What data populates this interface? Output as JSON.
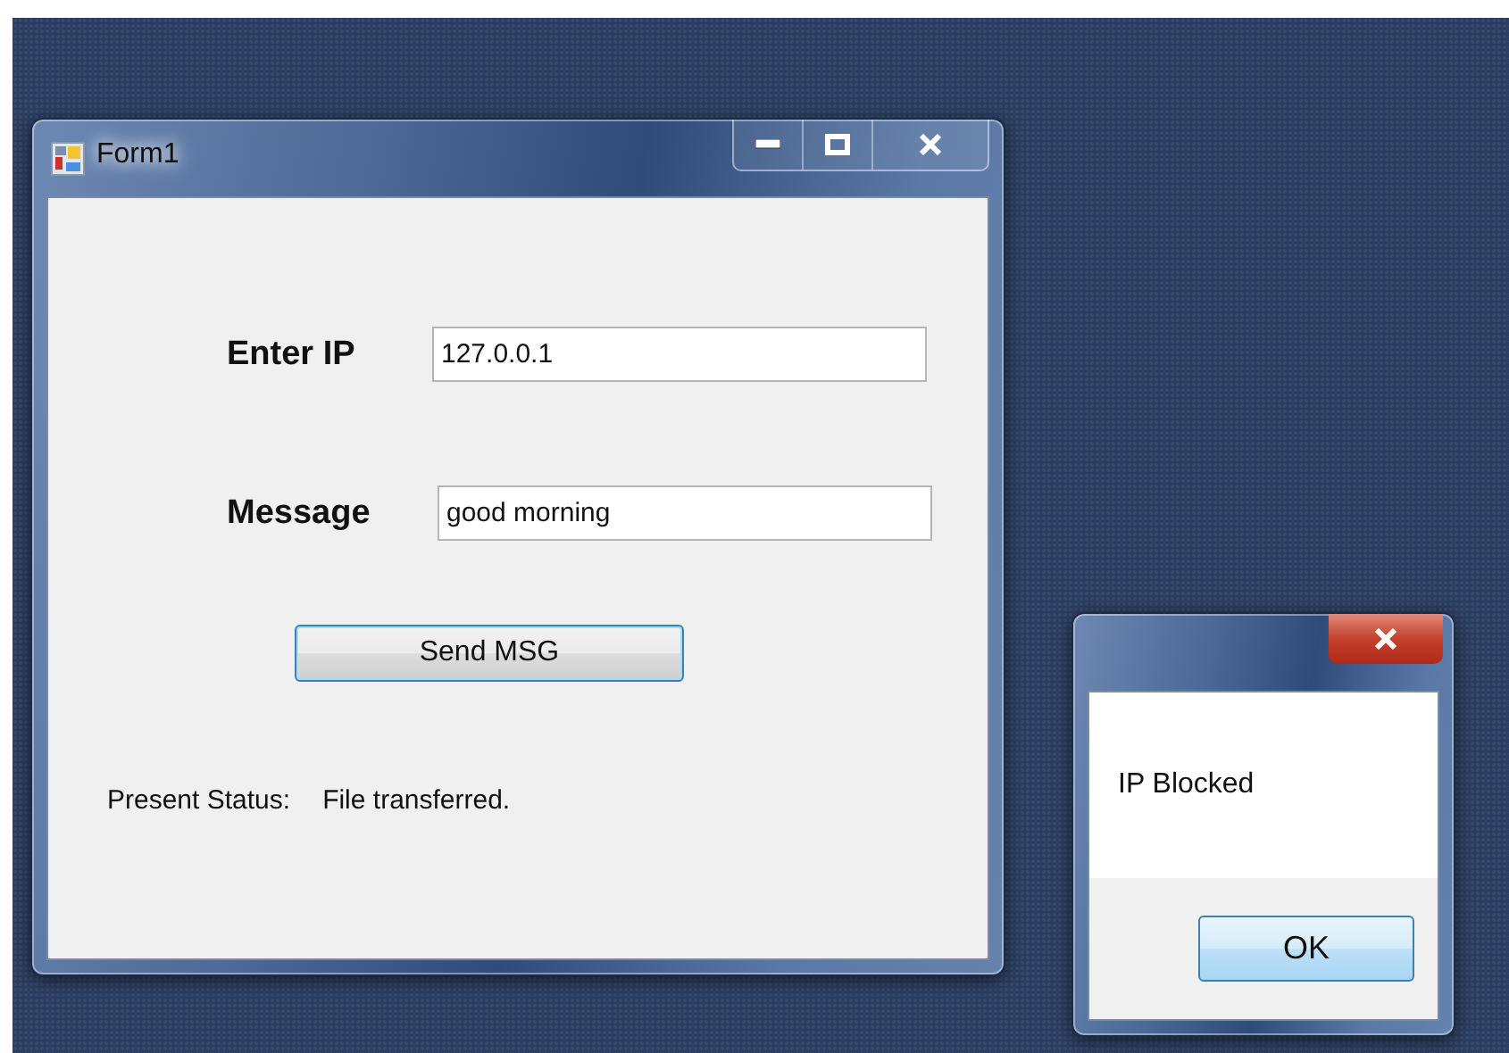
{
  "main_window": {
    "title": "Form1",
    "fields": [
      {
        "label": "Enter IP",
        "value": "127.0.0.1"
      },
      {
        "label": "Message",
        "value": "good morning"
      }
    ],
    "send_button": "Send MSG",
    "status": {
      "label": "Present Status:",
      "value": "File transferred."
    }
  },
  "dialog": {
    "message": "IP Blocked",
    "button": "OK"
  }
}
